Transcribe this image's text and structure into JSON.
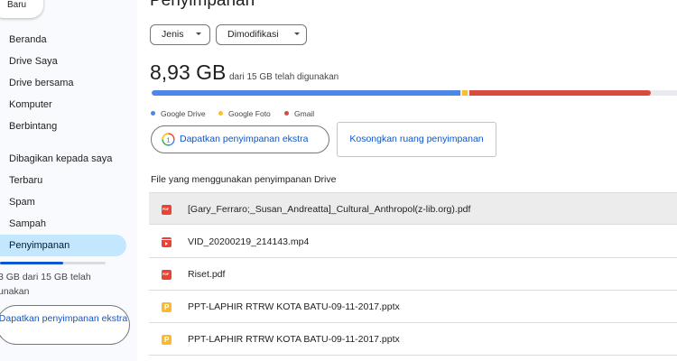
{
  "sidebar": {
    "new_label": "Baru",
    "items": [
      {
        "label": "Beranda"
      },
      {
        "label": "Drive Saya"
      },
      {
        "label": "Drive bersama"
      },
      {
        "label": "Komputer"
      },
      {
        "label": "Berbintang"
      },
      {
        "label": "Dibagikan kepada saya"
      },
      {
        "label": "Terbaru"
      },
      {
        "label": "Spam"
      },
      {
        "label": "Sampah"
      },
      {
        "label": "Penyimpanan",
        "active": true
      }
    ],
    "quota_text": "3 GB dari 15 GB telah unakan",
    "quota_fraction": 0.6,
    "cta_label": "Dapatkan penyimpanan ekstra"
  },
  "main": {
    "title": "Penyimpanan",
    "filters": [
      {
        "label": "Jenis"
      },
      {
        "label": "Dimodifikasi"
      }
    ],
    "usage": {
      "used": "8,93 GB",
      "of_total": "dari 15 GB telah digunakan",
      "breakdown_fraction_of_total": {
        "google_drive": 0.58,
        "google_foto": 0.01,
        "gmail": 0.34
      }
    },
    "legend": [
      {
        "label": "Google Drive",
        "color": "#4c86e8"
      },
      {
        "label": "Google Foto",
        "color": "#f7c02c"
      },
      {
        "label": "Gmail",
        "color": "#db4b3d"
      }
    ],
    "buttons": {
      "get_extra": "Dapatkan penyimpanan ekstra",
      "free_up": "Kosongkan ruang penyimpanan"
    },
    "list_title": "File yang menggunakan penyimpanan Drive",
    "files": [
      {
        "name": "[Gary_Ferraro;_Susan_Andreatta]_Cultural_Anthropol(z-lib.org).pdf",
        "type": "pdf-icon"
      },
      {
        "name": "VID_20200219_214143.mp4",
        "type": "video-icon"
      },
      {
        "name": "Riset.pdf",
        "type": "pdf-icon"
      },
      {
        "name": "PPT-LAPHIR RTRW KOTA BATU-09-11-2017.pptx",
        "type": "slides-icon"
      },
      {
        "name": "PPT-LAPHIR RTRW KOTA BATU-09-11-2017.pptx",
        "type": "slides-icon"
      }
    ]
  },
  "colors": {
    "accent": "#0b57d0",
    "active_nav": "#c2e7ff"
  }
}
